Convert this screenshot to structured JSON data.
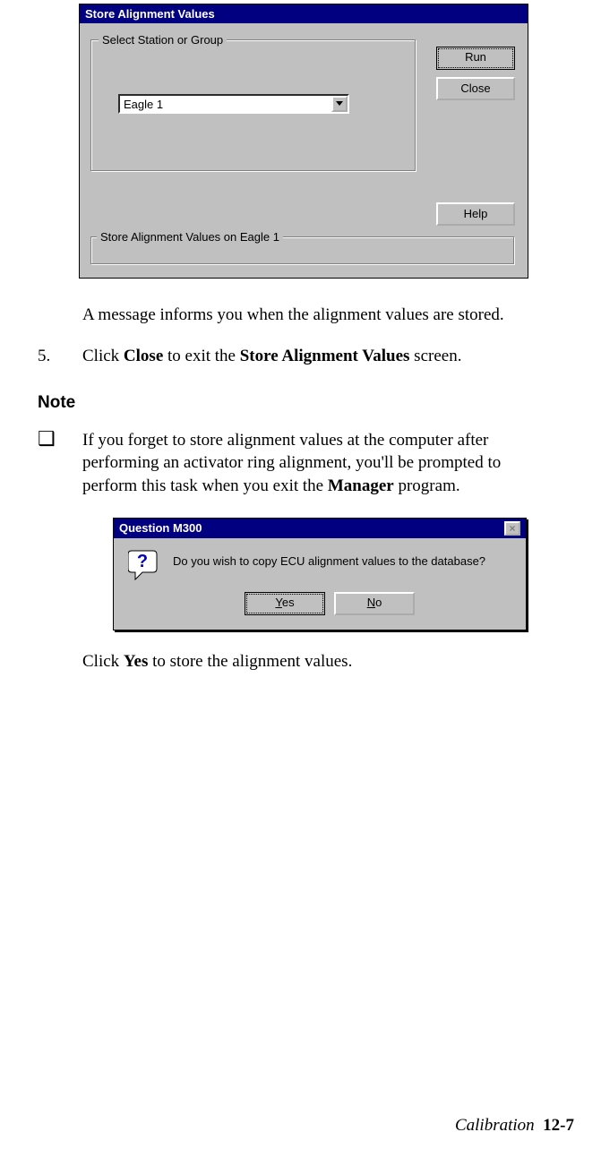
{
  "dialog1": {
    "title": "Store Alignment Values",
    "group_label": "Select Station or Group",
    "combo_value": "Eagle 1",
    "buttons": {
      "run": "Run",
      "close": "Close",
      "help": "Help"
    },
    "status": "Store Alignment Values on Eagle 1"
  },
  "body": {
    "para1": "A message informs you when the alignment values are stored.",
    "step5_num": "5.",
    "step5_a": "Click ",
    "step5_b": "Close",
    "step5_c": " to exit the ",
    "step5_d": "Store Alignment Values",
    "step5_e": " screen.",
    "note_heading": "Note",
    "note_a": "If you forget to store alignment values at the computer after performing an activator ring alignment, you'll be prompted to perform this task when you exit the ",
    "note_b": "Manager",
    "note_c": " program.",
    "para2_a": "Click ",
    "para2_b": "Yes",
    "para2_c": " to store the alignment values."
  },
  "dialog2": {
    "title": "Question M300",
    "message": "Do you wish to copy ECU alignment values to the database?",
    "yes_u": "Y",
    "yes_rest": "es",
    "no_u": "N",
    "no_rest": "o"
  },
  "footer": {
    "section": "Calibration",
    "page": "12-7"
  }
}
